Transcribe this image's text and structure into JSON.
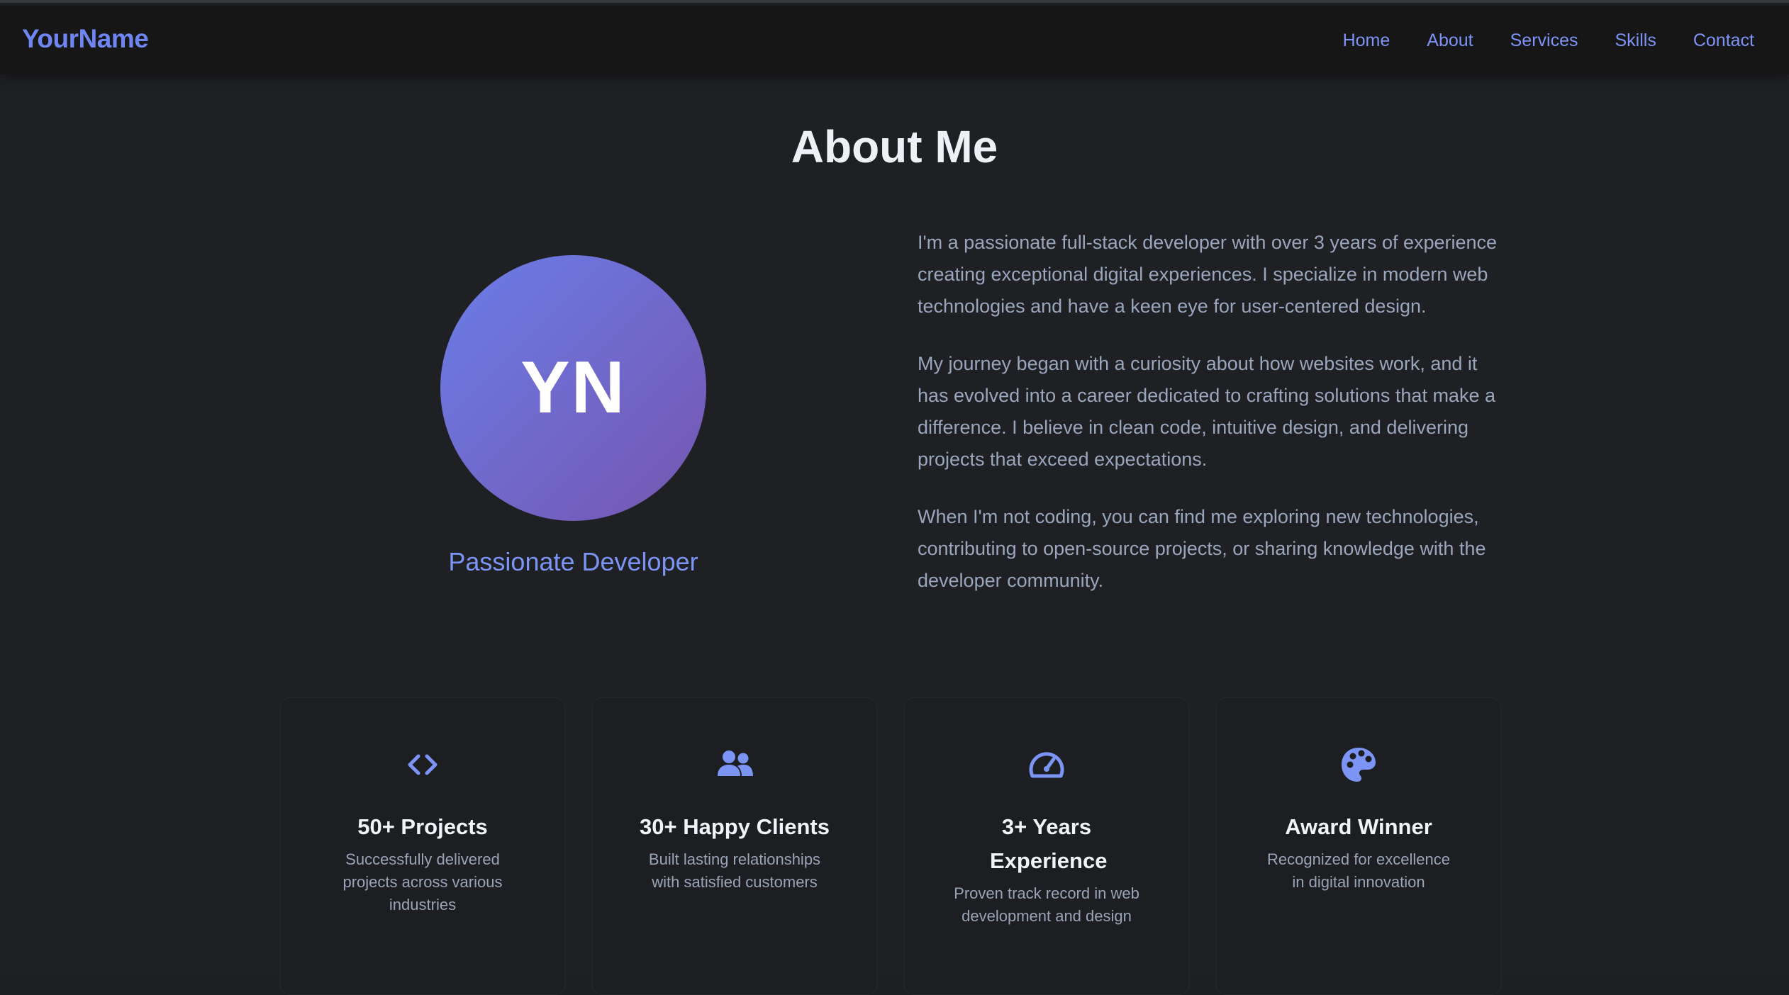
{
  "header": {
    "brand": "YourName",
    "nav": [
      "Home",
      "About",
      "Services",
      "Skills",
      "Contact"
    ]
  },
  "about": {
    "title": "About Me",
    "avatar_initials": "YN",
    "tagline": "Passionate Developer",
    "paragraphs": [
      "I'm a passionate full-stack developer with over 3 years of experience creating exceptional digital experiences. I specialize in modern web technologies and have a keen eye for user-centered design.",
      "My journey began with a curiosity about how websites work, and it has evolved into a career dedicated to crafting solutions that make a difference. I believe in clean code, intuitive design, and delivering projects that exceed expectations.",
      "When I'm not coding, you can find me exploring new technologies, contributing to open-source projects, or sharing knowledge with the developer community."
    ]
  },
  "cards": [
    {
      "icon": "code-icon",
      "title": "50+ Projects",
      "text": "Successfully delivered projects across various industries"
    },
    {
      "icon": "users-icon",
      "title": "30+ Happy Clients",
      "text": "Built lasting relationships with satisfied customers"
    },
    {
      "icon": "speedometer-icon",
      "title": "3+ Years Experience",
      "text": "Proven track record in web development and design"
    },
    {
      "icon": "palette-icon",
      "title": "Award Winner",
      "text": "Recognized for excellence in digital innovation"
    }
  ],
  "colors": {
    "accent": "#7c95f5",
    "background": "#1f2023",
    "header": "#161617",
    "avatar_gradient_start": "#6a7ee8",
    "avatar_gradient_end": "#7655b0"
  }
}
